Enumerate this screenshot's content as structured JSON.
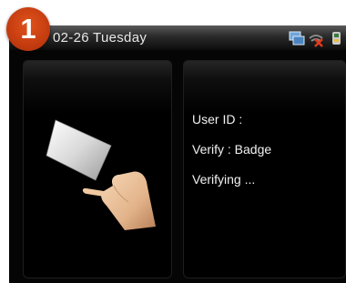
{
  "step_badge": "1",
  "status_bar": {
    "date_text": "02-26  Tuesday",
    "icons": [
      "network-icon",
      "wifi-disconnected-icon",
      "usb-icon"
    ]
  },
  "info_panel": {
    "user_id_label": "User ID :",
    "verify_label": "Verify : Badge",
    "status_text": "Verifying ..."
  },
  "colors": {
    "screen_background": "#050505",
    "text": "#f2f2f2",
    "badge": "#d14414",
    "disconnect_x": "#e23a1d",
    "network_icon": "#6fa6d8"
  }
}
